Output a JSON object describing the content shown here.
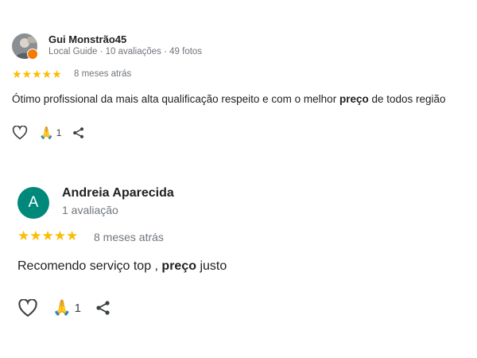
{
  "reviews": [
    {
      "author": "Gui Monstrão45",
      "meta": "Local Guide · 10 avaliações · 49 fotos",
      "stars": "★★★★★",
      "rating": 5,
      "date": "8 meses atrás",
      "text_before": "Ótimo profissional da mais alta qualificação respeito e com o melhor ",
      "text_bold": "preço",
      "text_after": " de todos região",
      "helpful_count": "1",
      "avatar_icon": "profile-photo",
      "badge_icon": "local-guide-badge-icon"
    },
    {
      "author": "Andreia Aparecida",
      "meta": "1 avaliação",
      "avatar_letter": "A",
      "stars": "★★★★★",
      "rating": 5,
      "date": "8 meses atrás",
      "text_before": "Recomendo serviço top , ",
      "text_bold": "preço",
      "text_after": " justo",
      "helpful_count": "1"
    }
  ],
  "colors": {
    "star": "#fbbc04",
    "avatar_teal": "#00897b",
    "badge": "#f57c00",
    "secondary_text": "#70757a"
  }
}
